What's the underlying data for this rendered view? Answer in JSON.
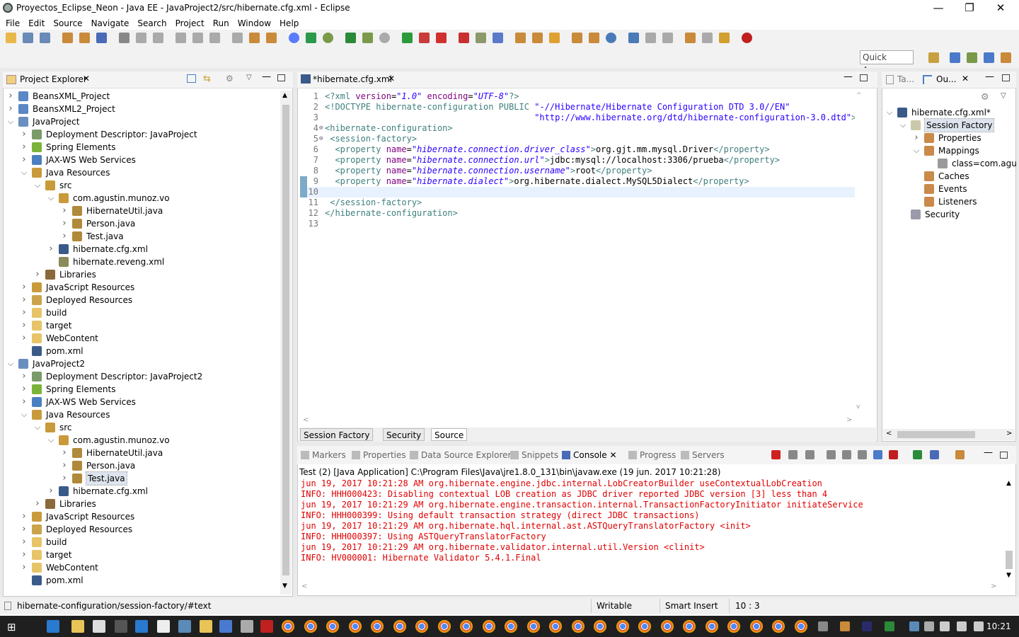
{
  "window": {
    "title": "Proyectos_Eclipse_Neon - Java EE - JavaProject2/src/hibernate.cfg.xml - Eclipse",
    "min": "—",
    "max": "❐",
    "close": "✕"
  },
  "menu": [
    "File",
    "Edit",
    "Source",
    "Navigate",
    "Search",
    "Project",
    "Run",
    "Window",
    "Help"
  ],
  "quick_access": "Quick Access",
  "project_explorer": {
    "tab": "Project Explorer",
    "items": [
      {
        "label": "BeansXML_Project",
        "depth": 0,
        "tw": "›",
        "icon": "folder-icon",
        "color": "#5a87c5"
      },
      {
        "label": "BeansXML2_Project",
        "depth": 0,
        "tw": "›",
        "icon": "folder-icon",
        "color": "#5a87c5"
      },
      {
        "label": "JavaProject",
        "depth": 0,
        "tw": "⌄",
        "icon": "project-icon",
        "color": "#6a8fbf"
      },
      {
        "label": "Deployment Descriptor: JavaProject",
        "depth": 1,
        "tw": "›",
        "icon": "descriptor-icon",
        "color": "#7a9a6a"
      },
      {
        "label": "Spring Elements",
        "depth": 1,
        "tw": "›",
        "icon": "spring-icon",
        "color": "#7bb33a"
      },
      {
        "label": "JAX-WS Web Services",
        "depth": 1,
        "tw": "›",
        "icon": "webservice-icon",
        "color": "#4a7fc1"
      },
      {
        "label": "Java Resources",
        "depth": 1,
        "tw": "⌄",
        "icon": "java-resources-icon",
        "color": "#c99a3a"
      },
      {
        "label": "src",
        "depth": 2,
        "tw": "⌄",
        "icon": "src-folder-icon",
        "color": "#c99a3a"
      },
      {
        "label": "com.agustin.munoz.vo",
        "depth": 3,
        "tw": "⌄",
        "icon": "package-icon",
        "color": "#c99a3a"
      },
      {
        "label": "HibernateUtil.java",
        "depth": 4,
        "tw": "›",
        "icon": "java-file-icon",
        "color": "#b08a3a"
      },
      {
        "label": "Person.java",
        "depth": 4,
        "tw": "›",
        "icon": "java-file-icon",
        "color": "#b08a3a"
      },
      {
        "label": "Test.java",
        "depth": 4,
        "tw": "›",
        "icon": "java-file-icon",
        "color": "#b08a3a"
      },
      {
        "label": "hibernate.cfg.xml",
        "depth": 3,
        "tw": "›",
        "icon": "xml-file-icon",
        "color": "#3a5a8a"
      },
      {
        "label": "hibernate.reveng.xml",
        "depth": 3,
        "tw": "",
        "icon": "reveng-icon",
        "color": "#8a8a5a"
      },
      {
        "label": "Libraries",
        "depth": 2,
        "tw": "›",
        "icon": "library-icon",
        "color": "#8a6a3a"
      },
      {
        "label": "JavaScript Resources",
        "depth": 1,
        "tw": "›",
        "icon": "js-resources-icon",
        "color": "#c99a3a"
      },
      {
        "label": "Deployed Resources",
        "depth": 1,
        "tw": "›",
        "icon": "deployed-icon",
        "color": "#c9a44a"
      },
      {
        "label": "build",
        "depth": 1,
        "tw": "›",
        "icon": "folder-icon",
        "color": "#e8c468"
      },
      {
        "label": "target",
        "depth": 1,
        "tw": "›",
        "icon": "folder-icon",
        "color": "#e8c468"
      },
      {
        "label": "WebContent",
        "depth": 1,
        "tw": "›",
        "icon": "folder-icon",
        "color": "#e8c468"
      },
      {
        "label": "pom.xml",
        "depth": 1,
        "tw": "",
        "icon": "maven-icon",
        "color": "#3a5a8a"
      },
      {
        "label": "JavaProject2",
        "depth": 0,
        "tw": "⌄",
        "icon": "project-icon",
        "color": "#6a8fbf"
      },
      {
        "label": "Deployment Descriptor: JavaProject2",
        "depth": 1,
        "tw": "›",
        "icon": "descriptor-icon",
        "color": "#7a9a6a"
      },
      {
        "label": "Spring Elements",
        "depth": 1,
        "tw": "›",
        "icon": "spring-icon",
        "color": "#7bb33a"
      },
      {
        "label": "JAX-WS Web Services",
        "depth": 1,
        "tw": "›",
        "icon": "webservice-icon",
        "color": "#4a7fc1"
      },
      {
        "label": "Java Resources",
        "depth": 1,
        "tw": "⌄",
        "icon": "java-resources-icon",
        "color": "#c99a3a"
      },
      {
        "label": "src",
        "depth": 2,
        "tw": "⌄",
        "icon": "src-folder-icon",
        "color": "#c99a3a"
      },
      {
        "label": "com.agustin.munoz.vo",
        "depth": 3,
        "tw": "⌄",
        "icon": "package-icon",
        "color": "#c99a3a"
      },
      {
        "label": "HibernateUtil.java",
        "depth": 4,
        "tw": "›",
        "icon": "java-file-icon",
        "color": "#b08a3a"
      },
      {
        "label": "Person.java",
        "depth": 4,
        "tw": "›",
        "icon": "java-file-icon",
        "color": "#b08a3a"
      },
      {
        "label": "Test.java",
        "depth": 4,
        "tw": "›",
        "icon": "java-file-icon",
        "color": "#b08a3a",
        "selected": true
      },
      {
        "label": "hibernate.cfg.xml",
        "depth": 3,
        "tw": "›",
        "icon": "xml-file-icon",
        "color": "#3a5a8a"
      },
      {
        "label": "Libraries",
        "depth": 2,
        "tw": "›",
        "icon": "library-icon",
        "color": "#8a6a3a"
      },
      {
        "label": "JavaScript Resources",
        "depth": 1,
        "tw": "›",
        "icon": "js-resources-icon",
        "color": "#c99a3a"
      },
      {
        "label": "Deployed Resources",
        "depth": 1,
        "tw": "›",
        "icon": "deployed-icon",
        "color": "#c9a44a"
      },
      {
        "label": "build",
        "depth": 1,
        "tw": "›",
        "icon": "folder-icon",
        "color": "#e8c468"
      },
      {
        "label": "target",
        "depth": 1,
        "tw": "›",
        "icon": "folder-icon",
        "color": "#e8c468"
      },
      {
        "label": "WebContent",
        "depth": 1,
        "tw": "›",
        "icon": "folder-icon",
        "color": "#e8c468"
      },
      {
        "label": "pom.xml",
        "depth": 1,
        "tw": "",
        "icon": "maven-icon",
        "color": "#3a5a8a"
      }
    ]
  },
  "editor": {
    "tab": "*hibernate.cfg.xml",
    "bottom_tabs": [
      "Session Factory",
      "Security",
      "Source"
    ],
    "active_bottom": "Source",
    "current_line": 10,
    "lines": [
      [
        [
          "pi",
          "<?xml "
        ],
        [
          "att",
          "version"
        ],
        [
          "txt",
          "="
        ],
        [
          "str",
          "\"1.0\""
        ],
        [
          "txt",
          " "
        ],
        [
          "att",
          "encoding"
        ],
        [
          "txt",
          "="
        ],
        [
          "str",
          "\"UTF-8\""
        ],
        [
          "pi",
          "?>"
        ]
      ],
      [
        [
          "pi",
          "<!DOCTYPE hibernate-configuration PUBLIC "
        ],
        [
          "str2",
          "\"-//Hibernate/Hibernate Configuration DTD 3.0//EN\""
        ]
      ],
      [
        [
          "str2",
          "                                         \"http://www.hibernate.org/dtd/hibernate-configuration-3.0.dtd\""
        ],
        [
          "pi",
          ">"
        ]
      ],
      [
        [
          "tag",
          "<hibernate-configuration>"
        ]
      ],
      [
        [
          "tag",
          " <session-factory>"
        ]
      ],
      [
        [
          "tag",
          "  <property "
        ],
        [
          "att",
          "name"
        ],
        [
          "txt",
          "="
        ],
        [
          "str",
          "\"hibernate.connection.driver_class\""
        ],
        [
          "tag",
          ">"
        ],
        [
          "txt",
          "org.gjt.mm.mysql.Driver"
        ],
        [
          "tag",
          "</property>"
        ]
      ],
      [
        [
          "tag",
          "  <property "
        ],
        [
          "att",
          "name"
        ],
        [
          "txt",
          "="
        ],
        [
          "str",
          "\"hibernate.connection.url\""
        ],
        [
          "tag",
          ">"
        ],
        [
          "txt",
          "jdbc:mysql://localhost:3306/prueba"
        ],
        [
          "tag",
          "</property>"
        ]
      ],
      [
        [
          "tag",
          "  <property "
        ],
        [
          "att",
          "name"
        ],
        [
          "txt",
          "="
        ],
        [
          "str",
          "\"hibernate.connection.username\""
        ],
        [
          "tag",
          ">"
        ],
        [
          "txt",
          "root"
        ],
        [
          "tag",
          "</property>"
        ]
      ],
      [
        [
          "tag",
          "  <property "
        ],
        [
          "att",
          "name"
        ],
        [
          "txt",
          "="
        ],
        [
          "str",
          "\"hibernate.dialect\""
        ],
        [
          "tag",
          ">"
        ],
        [
          "txt",
          "org.hibernate.dialect.MySQL5Dialect"
        ],
        [
          "tag",
          "</property>"
        ]
      ],
      [],
      [
        [
          "tag",
          " </session-factory>"
        ]
      ],
      [
        [
          "tag",
          "</hibernate-configuration>"
        ]
      ],
      []
    ]
  },
  "outline": {
    "tab1": "Ta...",
    "tab2": "Ou...",
    "items": [
      {
        "label": "hibernate.cfg.xml*",
        "depth": 0,
        "tw": "⌄",
        "icon": "xml-file-icon",
        "color": "#3a5a8a"
      },
      {
        "label": "Session Factory",
        "depth": 1,
        "tw": "⌄",
        "icon": "session-factory-icon",
        "color": "#c9c9a9",
        "selected": true
      },
      {
        "label": "Properties",
        "depth": 2,
        "tw": "›",
        "icon": "properties-icon",
        "color": "#c98a4a"
      },
      {
        "label": "Mappings",
        "depth": 2,
        "tw": "⌄",
        "icon": "mappings-icon",
        "color": "#c98a4a"
      },
      {
        "label": "class=com.agus",
        "depth": 3,
        "tw": "",
        "icon": "class-mapping-icon",
        "color": "#9a9a9a"
      },
      {
        "label": "Caches",
        "depth": 2,
        "tw": "",
        "icon": "caches-icon",
        "color": "#c98a4a"
      },
      {
        "label": "Events",
        "depth": 2,
        "tw": "",
        "icon": "events-icon",
        "color": "#c98a4a"
      },
      {
        "label": "Listeners",
        "depth": 2,
        "tw": "",
        "icon": "listeners-icon",
        "color": "#c98a4a"
      },
      {
        "label": "Security",
        "depth": 1,
        "tw": "",
        "icon": "security-icon",
        "color": "#9a9aaa"
      }
    ]
  },
  "console": {
    "tabs": [
      "Markers",
      "Properties",
      "Data Source Explorer",
      "Snippets",
      "Console",
      "Progress",
      "Servers"
    ],
    "active": "Console",
    "launch": "Test (2) [Java Application] C:\\Program Files\\Java\\jre1.8.0_131\\bin\\javaw.exe (19 jun. 2017 10:21:28)",
    "output": [
      "jun 19, 2017 10:21:28 AM org.hibernate.engine.jdbc.internal.LobCreatorBuilder useContextualLobCreation",
      "INFO: HHH000423: Disabling contextual LOB creation as JDBC driver reported JDBC version [3] less than 4",
      "jun 19, 2017 10:21:29 AM org.hibernate.engine.transaction.internal.TransactionFactoryInitiator initiateService",
      "INFO: HHH000399: Using default transaction strategy (direct JDBC transactions)",
      "jun 19, 2017 10:21:29 AM org.hibernate.hql.internal.ast.ASTQueryTranslatorFactory <init>",
      "INFO: HHH000397: Using ASTQueryTranslatorFactory",
      "jun 19, 2017 10:21:29 AM org.hibernate.validator.internal.util.Version <clinit>",
      "INFO: HV000001: Hibernate Validator 5.4.1.Final"
    ]
  },
  "status": {
    "path": "hibernate-configuration/session-factory/#text",
    "writable": "Writable",
    "insert_mode": "Smart Insert",
    "position": "10 : 3"
  },
  "taskbar": {
    "clock": "10:21"
  }
}
